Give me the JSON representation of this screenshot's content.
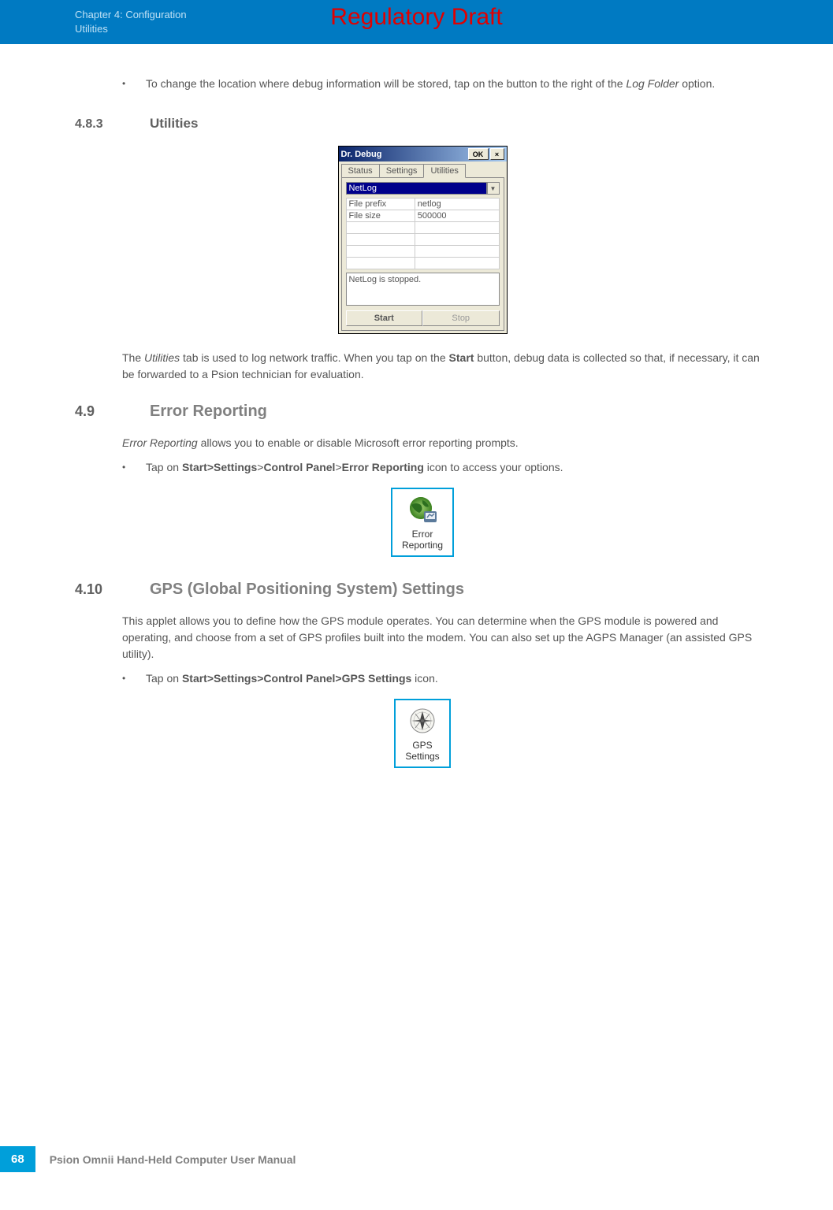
{
  "watermark": "Regulatory Draft",
  "header": {
    "line1": "Chapter 4:  Configuration",
    "line2": "Utilities"
  },
  "bullet1": {
    "text_before": "To change the location where debug information will be stored, tap on the button to the right of the ",
    "italic": "Log Folder",
    "text_after": " option."
  },
  "sec483": {
    "num": "4.8.3",
    "title": "Utilities"
  },
  "dialog": {
    "title": "Dr. Debug",
    "ok": "OK",
    "close": "×",
    "tabs": {
      "status": "Status",
      "settings": "Settings",
      "utilities": "Utilities"
    },
    "dropdown": "NetLog",
    "rows": [
      {
        "k": "File prefix",
        "v": "netlog"
      },
      {
        "k": "File size",
        "v": "500000"
      }
    ],
    "status_msg": "NetLog is stopped.",
    "start": "Start",
    "stop": "Stop"
  },
  "para1": {
    "before": "The ",
    "italic": "Utilities",
    "mid": " tab is used to log network traffic. When you tap on the ",
    "bold": "Start",
    "after": " button, debug data is collected so that, if necessary, it can be forwarded to a Psion technician for evaluation."
  },
  "sec49": {
    "num": "4.9",
    "title": "Error Reporting"
  },
  "para2": {
    "italic": "Error Reporting",
    "after": " allows you to enable or disable Microsoft error reporting prompts."
  },
  "bullet2": {
    "before": "Tap on ",
    "b1": "Start>Settings",
    "g1": ">",
    "b2": "Control Panel",
    "g2": ">",
    "b3": "Error Reporting",
    "after": " icon to access your options."
  },
  "icon_err": {
    "line1": "Error",
    "line2": "Reporting"
  },
  "sec410": {
    "num": "4.10",
    "title": "GPS (Global Positioning System) Settings"
  },
  "para3": "This applet allows you to define how the GPS module operates. You can determine when the GPS module is powered and operating, and choose from a set of GPS profiles built into the modem. You can also set up the AGPS Manager (an assisted GPS utility).",
  "bullet3": {
    "before": "Tap on ",
    "bold": "Start>Settings>Control Panel>GPS Settings",
    "after": " icon."
  },
  "icon_gps": {
    "line1": "GPS",
    "line2": "Settings"
  },
  "footer": {
    "page": "68",
    "text": "Psion Omnii Hand-Held Computer User Manual"
  }
}
